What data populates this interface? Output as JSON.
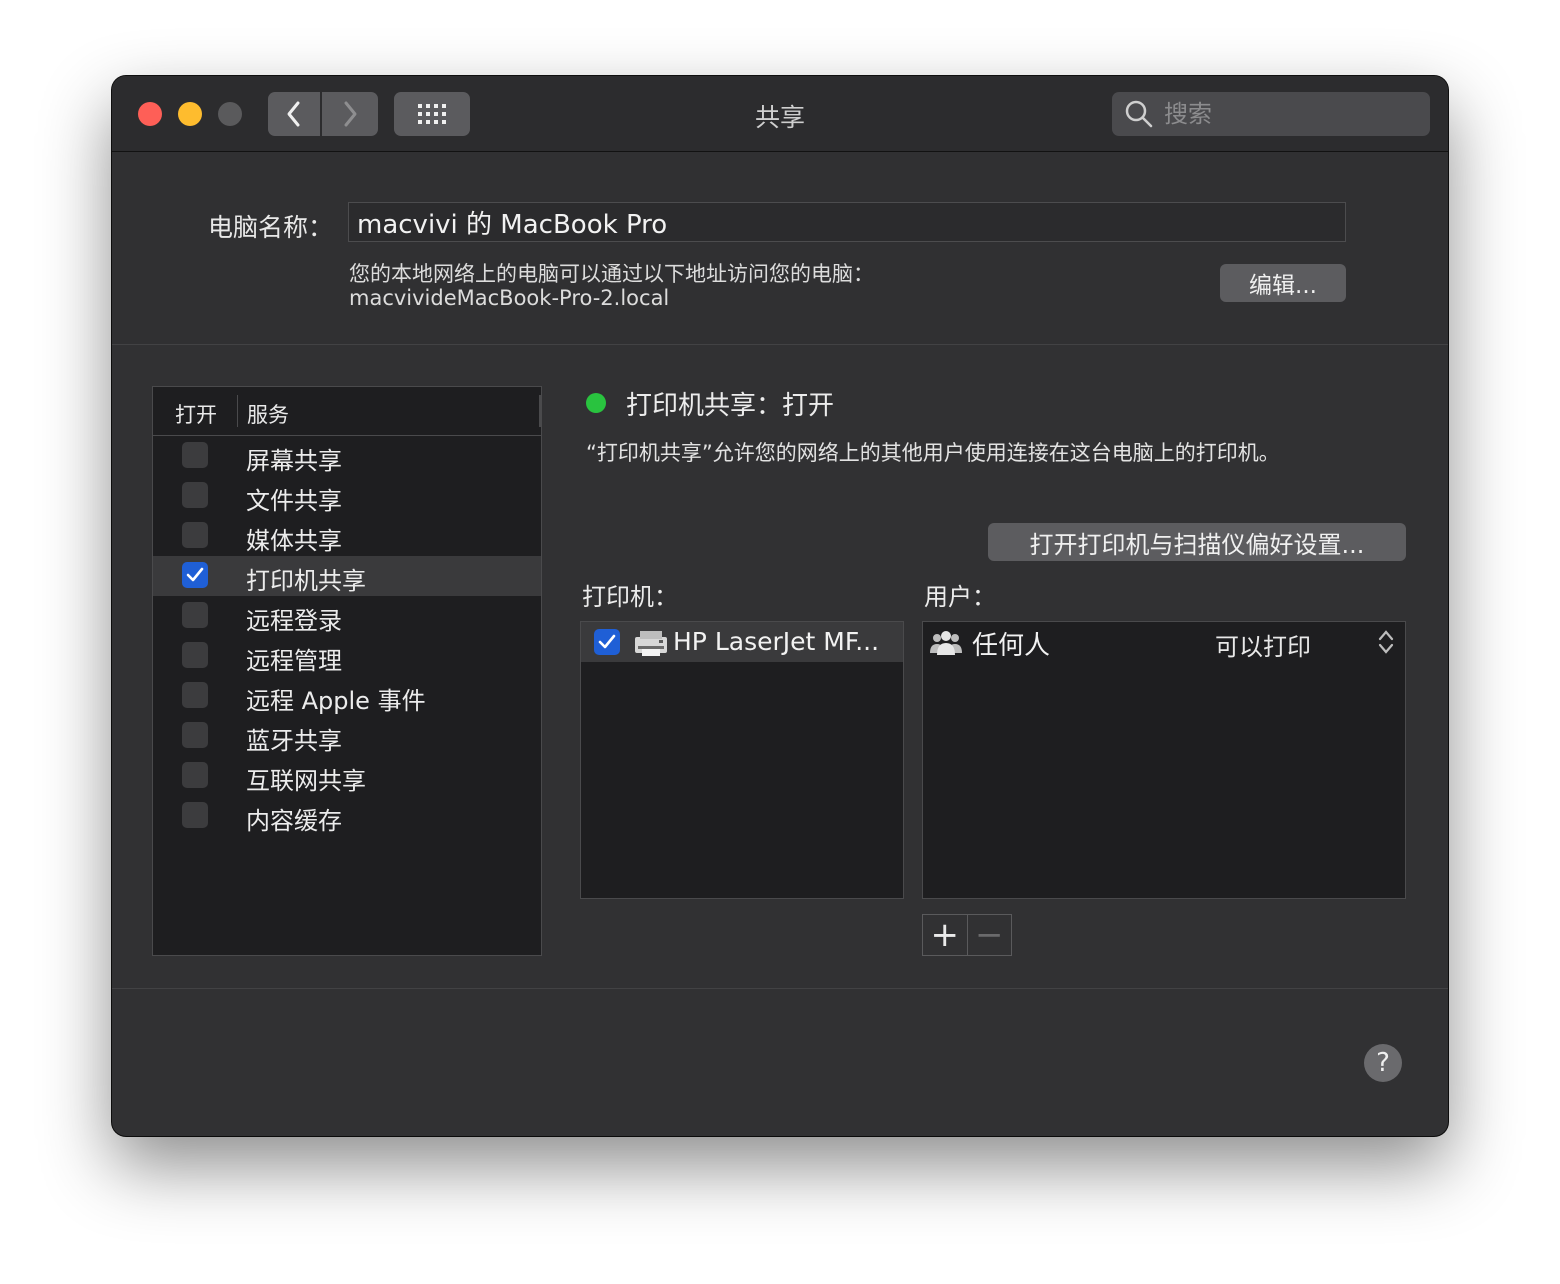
{
  "window": {
    "title": "共享",
    "search": {
      "placeholder": "搜索"
    }
  },
  "computer": {
    "name_label": "电脑名称：",
    "name_value": "macvivi 的 MacBook Pro",
    "address_description": "您的本地网络上的电脑可以通过以下地址访问您的电脑：",
    "address": "macvivideMacBook-Pro-2.local",
    "edit_button": "编辑..."
  },
  "services": {
    "header_open": "打开",
    "header_service": "服务",
    "items": [
      {
        "label": "屏幕共享",
        "checked": false
      },
      {
        "label": "文件共享",
        "checked": false
      },
      {
        "label": "媒体共享",
        "checked": false
      },
      {
        "label": "打印机共享",
        "checked": true,
        "selected": true
      },
      {
        "label": "远程登录",
        "checked": false
      },
      {
        "label": "远程管理",
        "checked": false
      },
      {
        "label": "远程 Apple 事件",
        "checked": false
      },
      {
        "label": "蓝牙共享",
        "checked": false
      },
      {
        "label": "互联网共享",
        "checked": false
      },
      {
        "label": "内容缓存",
        "checked": false
      }
    ]
  },
  "detail": {
    "status_text": "打印机共享：打开",
    "status_color": "#29c33f",
    "description": "“打印机共享”允许您的网络上的其他用户使用连接在这台电脑上的打印机。",
    "printer_prefs_button": "打开打印机与扫描仪偏好设置...",
    "printers_label": "打印机：",
    "users_label": "用户：",
    "printers": [
      {
        "name": "HP LaserJet MF...",
        "checked": true,
        "icon": "printer-icon"
      }
    ],
    "users": [
      {
        "name": "任何人",
        "permission": "可以打印",
        "icon": "group-icon"
      }
    ],
    "add_label": "+",
    "remove_label": "−"
  },
  "help_label": "?"
}
